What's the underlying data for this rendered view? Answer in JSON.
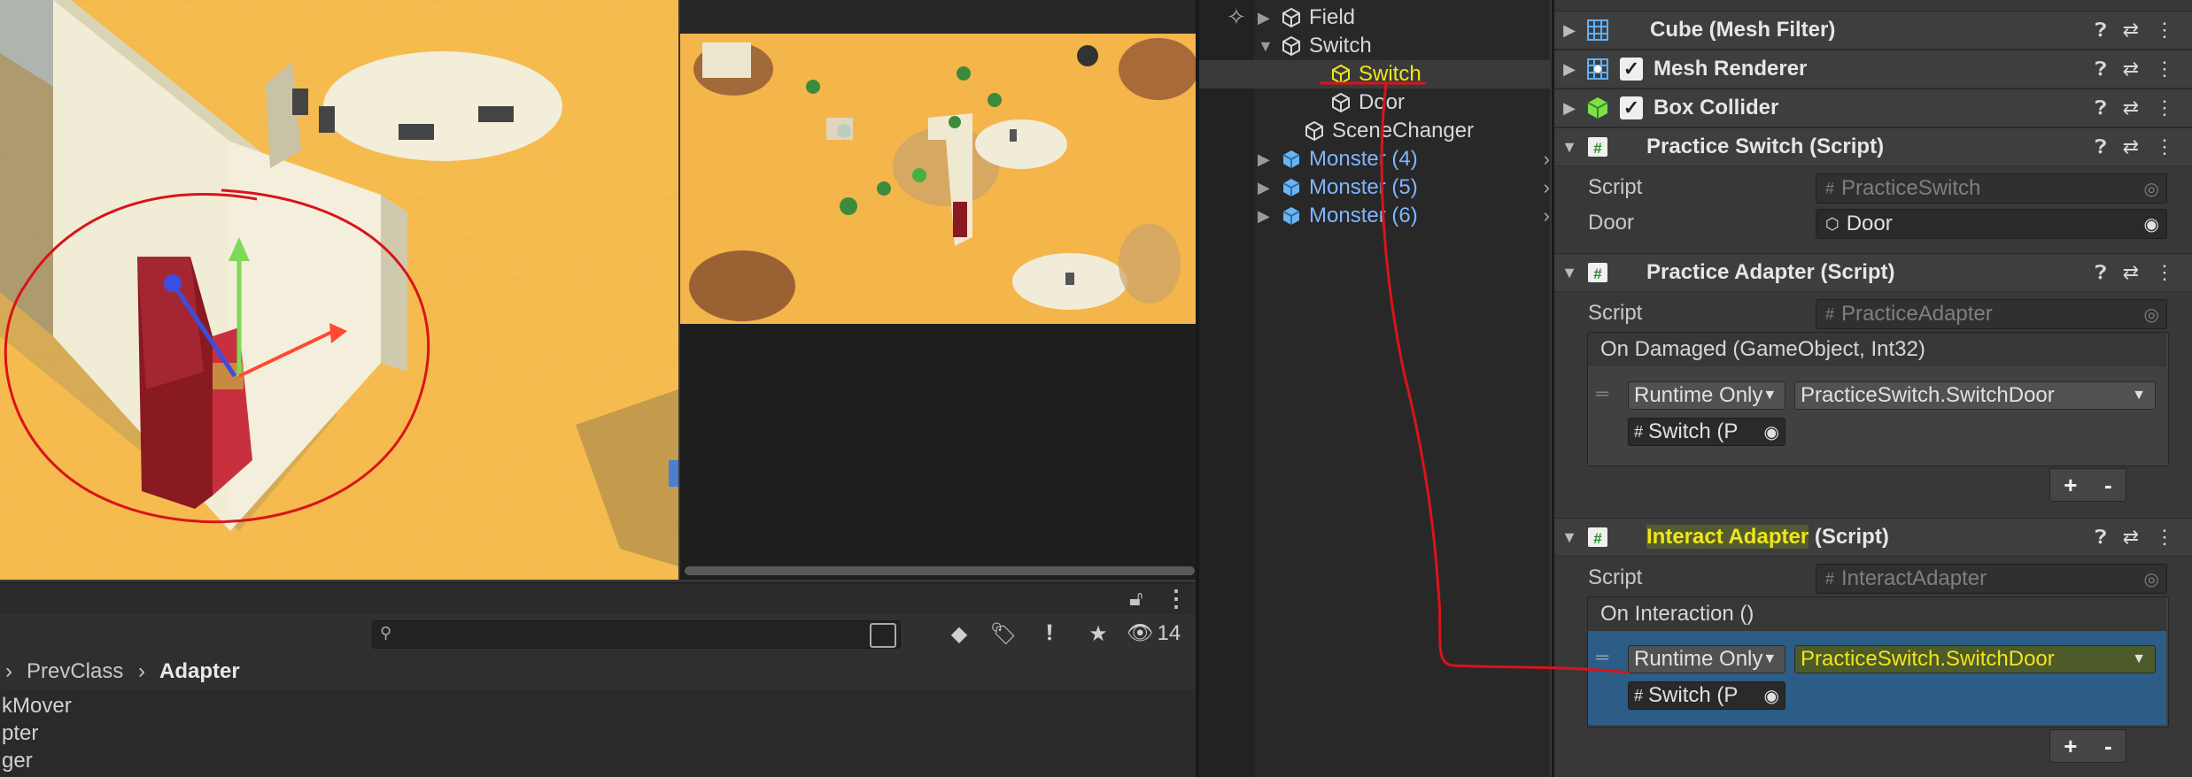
{
  "hierarchy": {
    "items": [
      {
        "label": "Field",
        "color": "#d8d8d8",
        "expanded": false
      },
      {
        "label": "Switch",
        "color": "#d8d8d8",
        "expanded": true
      },
      {
        "label": "Switch",
        "color": "#f1e51a",
        "selected": true
      },
      {
        "label": "Door",
        "color": "#d8d8d8"
      },
      {
        "label": "SceneChanger",
        "color": "#d8d8d8"
      },
      {
        "label": "Monster (4)",
        "color": "#7fb5ff",
        "prefab": true
      },
      {
        "label": "Monster (5)",
        "color": "#7fb5ff",
        "prefab": true
      },
      {
        "label": "Monster (6)",
        "color": "#7fb5ff",
        "prefab": true
      }
    ]
  },
  "inspector": {
    "cube_mesh_filter": "Cube (Mesh Filter)",
    "mesh_renderer": "Mesh Renderer",
    "box_collider": "Box Collider",
    "practice_switch": {
      "title": "Practice Switch (Script)",
      "script_label": "Script",
      "script_value": "PracticeSwitch",
      "door_label": "Door",
      "door_value": "Door"
    },
    "practice_adapter": {
      "title": "Practice Adapter (Script)",
      "script_label": "Script",
      "script_value": "PracticeAdapter",
      "event_header": "On Damaged (GameObject, Int32)",
      "runtime": "Runtime Only",
      "function": "PracticeSwitch.SwitchDoor",
      "object": "Switch (P"
    },
    "interact_adapter": {
      "title_highlight": "Interact Adapter",
      "title_rest": " (Script)",
      "script_label": "Script",
      "script_value": "InteractAdapter",
      "event_header": "On Interaction ()",
      "runtime": "Runtime Only",
      "function": "PracticeSwitch.SwitchDoor",
      "object": "Switch (P"
    },
    "plus": "+",
    "minus": "-"
  },
  "project": {
    "search_placeholder": "",
    "visible_count": "14",
    "breadcrumb": [
      "PrevClass",
      "Adapter"
    ],
    "items": [
      "kMover",
      "pter",
      "ger"
    ]
  },
  "colors": {
    "highlight_yellow": "#f1e51a",
    "prefab_blue": "#7fb5ff",
    "selection_blue": "#2c5d87",
    "annotation_red": "#d9141a"
  }
}
